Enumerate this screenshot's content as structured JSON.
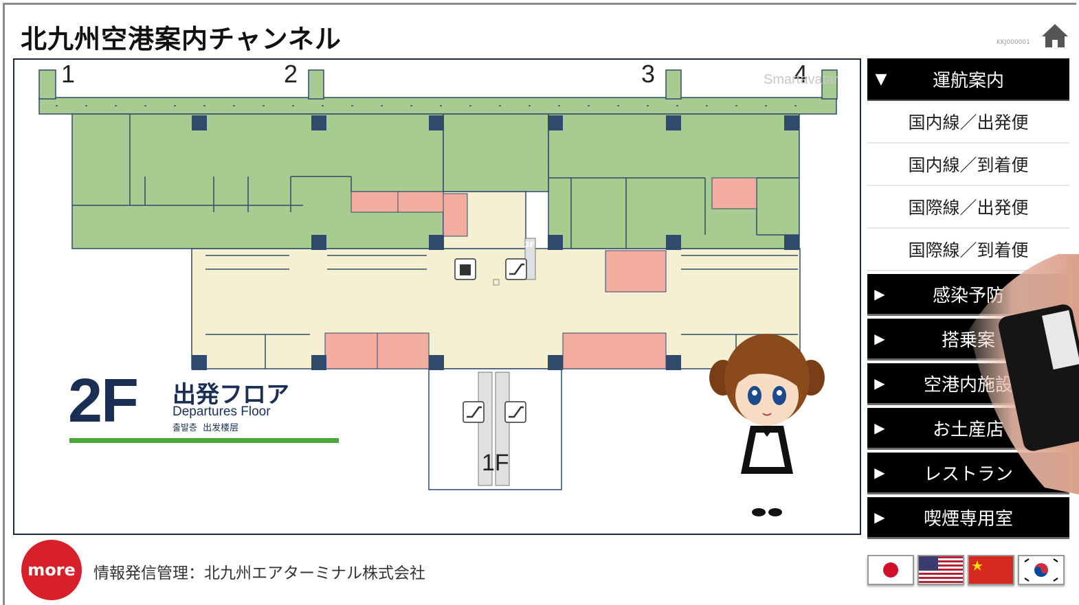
{
  "header": {
    "title": "北九州空港案内チャンネル",
    "kiosk_id": "KKJ000001"
  },
  "map": {
    "gate_numbers": [
      "1",
      "2",
      "3",
      "4"
    ],
    "floor_code": "2F",
    "floor_name_ja": "出発フロア",
    "floor_name_en": "Departures Floor",
    "floor_name_sub": "출발층  出发楼层",
    "upper_floor_tag": "3F",
    "lower_floor_tag": "1F",
    "watermark": "Smartavatar",
    "colors": {
      "office": "#a7cb91",
      "public": "#f5f0d2",
      "shop": "#f3aca0",
      "wall": "#2f4a6b",
      "floor_bar": "#4aa83a"
    }
  },
  "menu": {
    "flight_info": {
      "label": "運航案内",
      "items": [
        "国内線／出発便",
        "国内線／到着便",
        "国際線／出発便",
        "国際線／到着便"
      ]
    },
    "categories": [
      "感染予防",
      "搭乗案",
      "空港内施設",
      "お土産店",
      "レストラン",
      "喫煙専用室"
    ]
  },
  "footer": {
    "more_label": "more",
    "operator_text": "情報発信管理：北九州エアターミナル株式会社",
    "languages": [
      "japanese-flag",
      "us-flag",
      "china-flag",
      "korea-flag"
    ]
  }
}
